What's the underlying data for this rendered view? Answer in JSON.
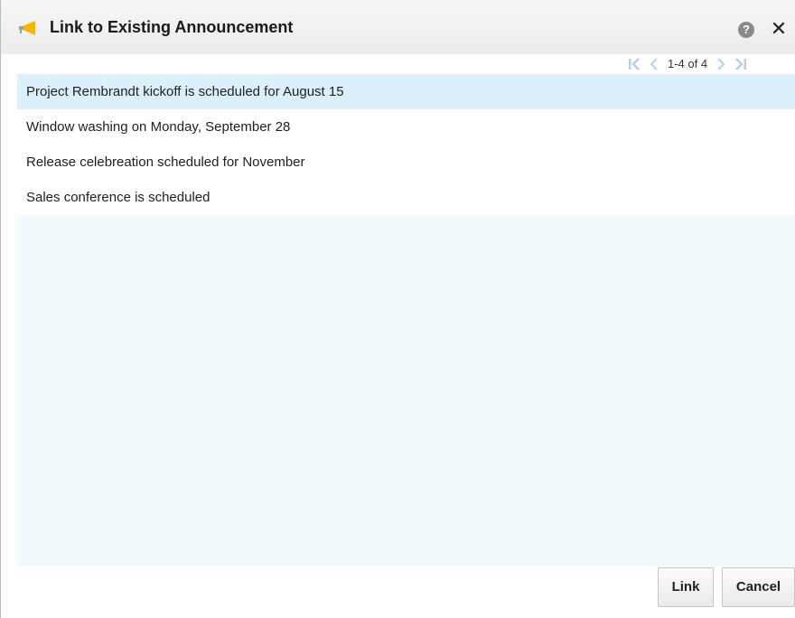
{
  "dialog": {
    "title": "Link to Existing Announcement",
    "title_icon": "megaphone-icon",
    "help_icon": "help-icon",
    "help_glyph": "?",
    "close_icon": "close-icon",
    "close_glyph": "✕"
  },
  "pager": {
    "range_text": "1-4 of 4",
    "icons": [
      "first-page-icon",
      "previous-page-icon",
      "next-page-icon",
      "last-page-icon"
    ]
  },
  "announcements": [
    {
      "label": "Project Rembrandt kickoff is scheduled for August 15",
      "selected": true
    },
    {
      "label": "Window washing on Monday, September 28",
      "selected": false
    },
    {
      "label": "Release celebreation scheduled for November",
      "selected": false
    },
    {
      "label": "Sales conference is scheduled",
      "selected": false
    }
  ],
  "buttons": {
    "link_label": "Link",
    "cancel_label": "Cancel"
  },
  "colors": {
    "title_bar": "#ececec",
    "selected_row": "#dcf0fb",
    "list_background": "#f1fafd",
    "megaphone": "#f5b800",
    "pager_active": "#4a90c8",
    "pager_disabled": "#b9cfe4"
  }
}
